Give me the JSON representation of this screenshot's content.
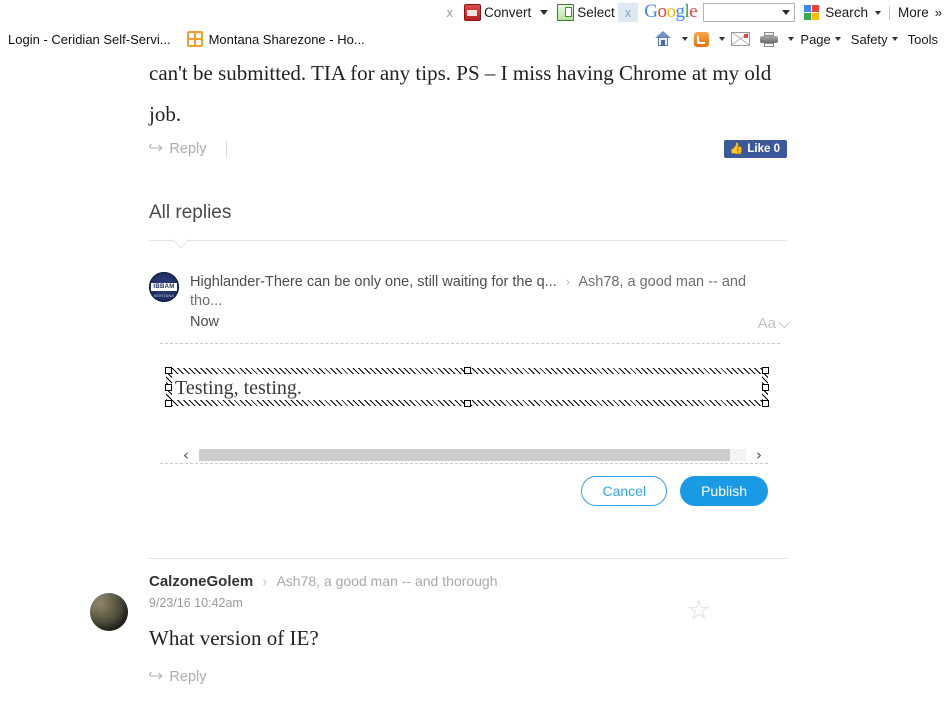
{
  "browser": {
    "addon_toolbar": {
      "close_label": "x",
      "convert_label": "Convert",
      "select_label": "Select",
      "google_close_label": "x",
      "google_logo": [
        "G",
        "o",
        "o",
        "g",
        "l",
        "e"
      ],
      "search_value": "",
      "search_label": "Search",
      "more_label": "More",
      "more_chevron": "»"
    },
    "tabs": [
      {
        "title": "Login - Ceridian Self-Servi...",
        "icon": "none"
      },
      {
        "title": "Montana Sharezone - Ho...",
        "icon": "sharezone-icon"
      }
    ],
    "command_bar": [
      {
        "label": "",
        "icon": "home-icon",
        "has_caret": true
      },
      {
        "label": "",
        "icon": "rss-icon",
        "has_caret": true
      },
      {
        "label": "",
        "icon": "mail-icon",
        "has_caret": false
      },
      {
        "label": "",
        "icon": "print-icon",
        "has_caret": true
      },
      {
        "label": "Page",
        "icon": "none",
        "has_caret": true
      },
      {
        "label": "Safety",
        "icon": "none",
        "has_caret": true
      },
      {
        "label": "Tools",
        "icon": "none",
        "has_caret": false
      }
    ]
  },
  "post": {
    "body": "can't be submitted. TIA for any tips. PS – I miss having Chrome at my old job.",
    "reply_label": "Reply",
    "reply_arrow": "↪",
    "like_label": "Like 0",
    "like_icon": "👍"
  },
  "replies_section": {
    "heading": "All replies"
  },
  "reply_editor": {
    "avatar_text": "IBBAM",
    "avatar_subtext": "MONTANA",
    "breadcrumb_user": "Highlander-There can be only one, still waiting for the q...",
    "breadcrumb_sep": "›",
    "breadcrumb_thread": "Ash78, a good man -- and tho...",
    "timestamp": "Now",
    "font_control_label": "Aa",
    "editor_text": "Testing, testing.",
    "scroll_left_icon": "‹",
    "scroll_right_icon": "›",
    "cancel_label": "Cancel",
    "publish_label": "Publish"
  },
  "comment": {
    "author": "CalzoneGolem",
    "breadcrumb_sep": "›",
    "thread": "Ash78, a good man -- and thorough",
    "date": "9/23/16 10:42am",
    "body": "What version of IE?",
    "reply_label": "Reply",
    "reply_arrow": "↪",
    "star_icon": "☆"
  },
  "colors": {
    "publish_blue": "#1a9ae5",
    "cancel_blue": "#32a4e8",
    "facebook_blue": "#3b5998",
    "avatar_navy": "#1f2f63"
  }
}
